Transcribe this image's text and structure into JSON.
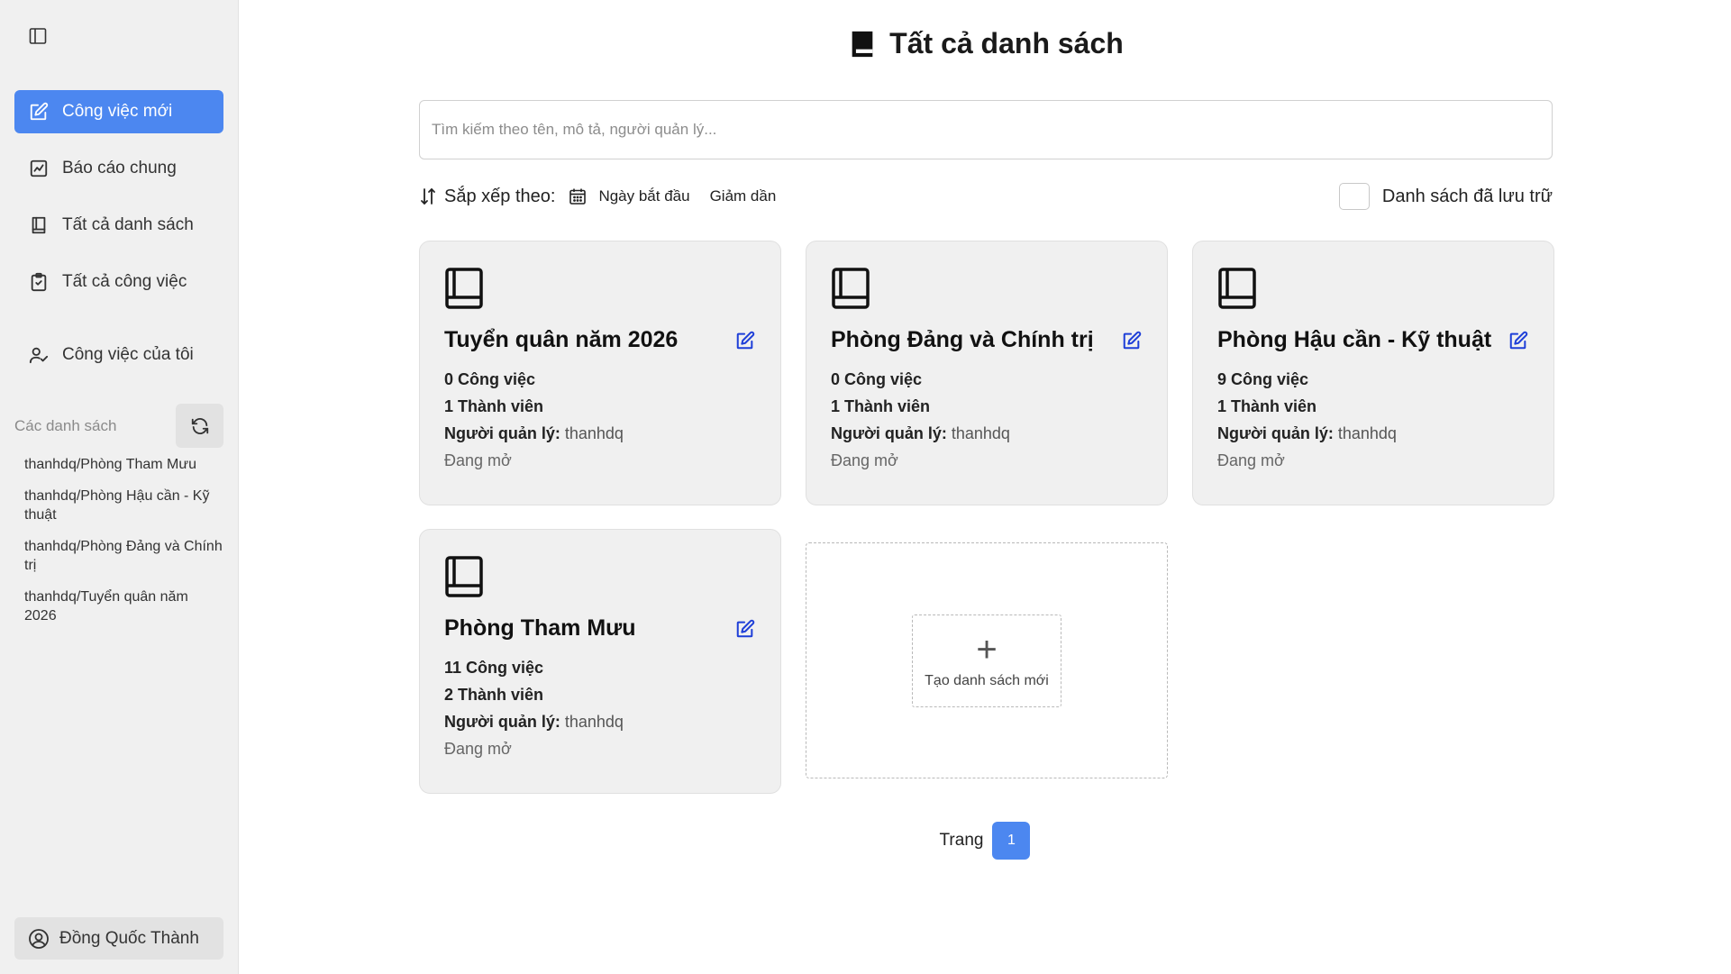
{
  "colors": {
    "accent": "#4c87f0",
    "sidebar_bg": "#f0f0f0",
    "card_bg": "#f0f0f0",
    "edit_icon": "#1e3fd8"
  },
  "sidebar": {
    "toggle_icon": "sidebar-panel-icon",
    "nav": [
      {
        "label": "Công việc mới",
        "icon": "edit-square-icon",
        "active": true
      },
      {
        "label": "Báo cáo chung",
        "icon": "chart-icon",
        "active": false
      },
      {
        "label": "Tất cả danh sách",
        "icon": "book-icon",
        "active": false
      },
      {
        "label": "Tất cả công việc",
        "icon": "clipboard-check-icon",
        "active": false
      },
      {
        "label": "Công việc của tôi",
        "icon": "user-check-icon",
        "active": false
      }
    ],
    "lists_title": "Các danh sách",
    "lists": [
      "thanhdq/Phòng Tham Mưu",
      "thanhdq/Phòng Hậu cần - Kỹ thuật",
      "thanhdq/Phòng Đảng và Chính trị",
      "thanhdq/Tuyển quân năm 2026"
    ],
    "user_name": "Đồng Quốc Thành"
  },
  "main": {
    "title": "Tất cả danh sách",
    "search_placeholder": "Tìm kiếm theo tên, mô tả, người quản lý...",
    "sort_label": "Sắp xếp theo:",
    "sort_field": "Ngày bắt đầu",
    "sort_direction": "Giảm dần",
    "archive_label": "Danh sách đã lưu trữ",
    "archive_checked": false,
    "manager_label": "Người quản lý:",
    "cards": [
      {
        "name": "Tuyển quân năm 2026",
        "tasks": "0 Công việc",
        "members": "1 Thành viên",
        "manager": "thanhdq",
        "status": "Đang mở"
      },
      {
        "name": "Phòng Đảng và Chính trị",
        "tasks": "0 Công việc",
        "members": "1 Thành viên",
        "manager": "thanhdq",
        "status": "Đang mở"
      },
      {
        "name": "Phòng Hậu cần - Kỹ thuật",
        "tasks": "9 Công việc",
        "members": "1 Thành viên",
        "manager": "thanhdq",
        "status": "Đang mở"
      },
      {
        "name": "Phòng Tham Mưu",
        "tasks": "11 Công việc",
        "members": "2 Thành viên",
        "manager": "thanhdq",
        "status": "Đang mở"
      }
    ],
    "new_list_label": "Tạo danh sách mới",
    "pagination": {
      "label": "Trang",
      "current": "1"
    }
  }
}
